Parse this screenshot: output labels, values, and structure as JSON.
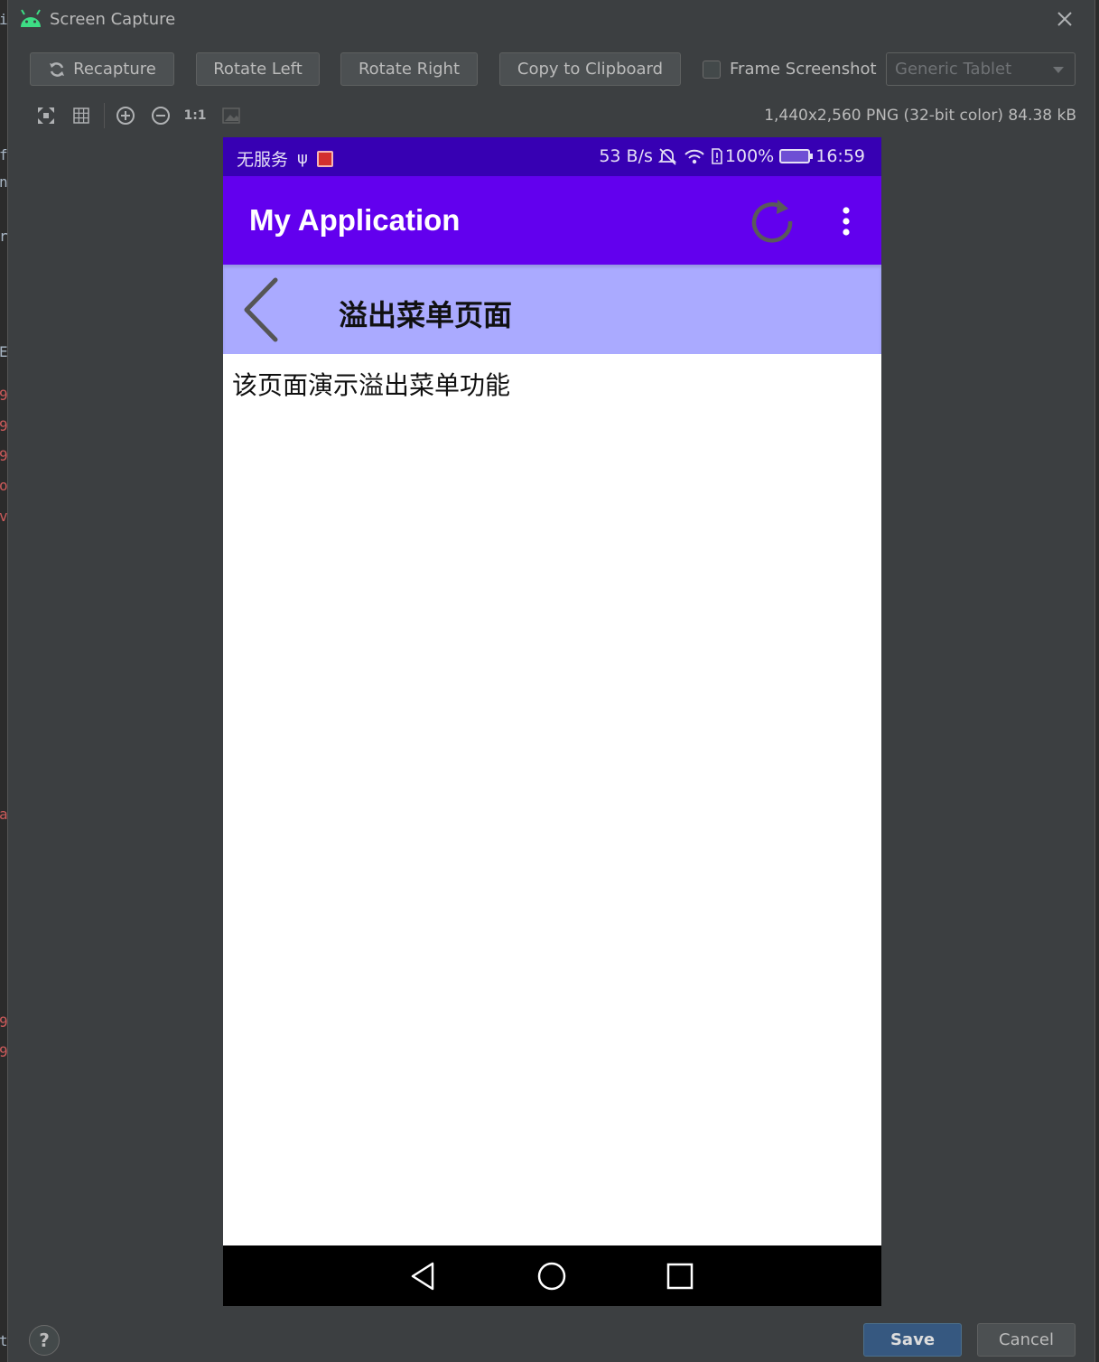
{
  "dialog": {
    "title": "Screen Capture",
    "close_icon": "close-icon"
  },
  "toolbar": {
    "recapture_label": "Recapture",
    "rotate_left_label": "Rotate Left",
    "rotate_right_label": "Rotate Right",
    "copy_label": "Copy to Clipboard",
    "frame_screenshot_label": "Frame Screenshot",
    "frame_screenshot_checked": false,
    "device_frame_value": "Generic Tablet",
    "one_to_one_label": "1:1",
    "image_info": "1,440x2,560 PNG (32-bit color) 84.38 kB"
  },
  "phone": {
    "status_bar": {
      "carrier": "无服务",
      "net_speed": "53 B/s",
      "battery": "100%",
      "time": "16:59"
    },
    "app_bar": {
      "title": "My Application",
      "bg_color": "#6200ee"
    },
    "sub_bar": {
      "title": "溢出菜单页面",
      "bg_color": "#aaaaff"
    },
    "content_text": "该页面演示溢出菜单功能"
  },
  "footer": {
    "help_label": "?",
    "save_label": "Save",
    "cancel_label": "Cancel"
  }
}
